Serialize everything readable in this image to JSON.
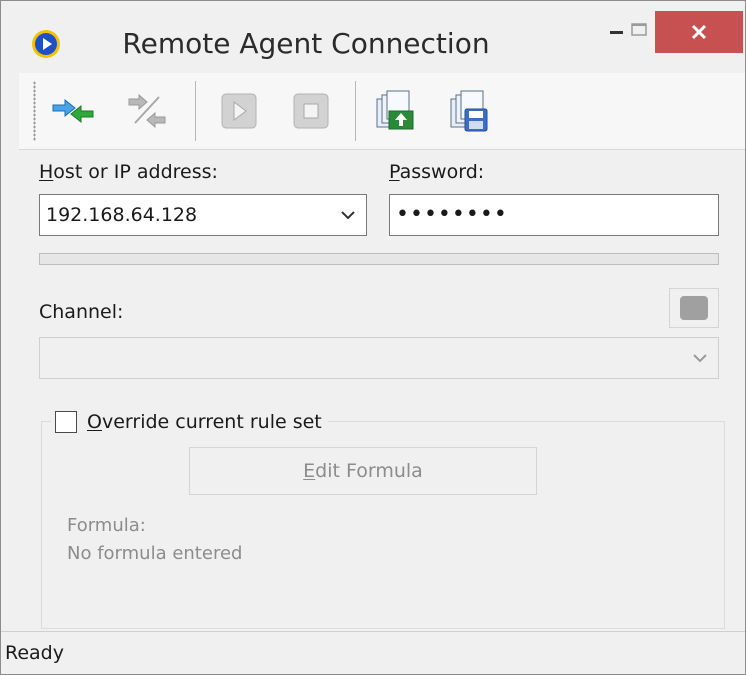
{
  "window": {
    "title": "Remote Agent Connection"
  },
  "toolbar": {
    "buttons": [
      {
        "icon": "connect-icon",
        "enabled": true
      },
      {
        "icon": "disconnect-icon",
        "enabled": false
      },
      {
        "icon": "play-icon",
        "enabled": false
      },
      {
        "icon": "stop-icon",
        "enabled": false
      },
      {
        "icon": "export-icon",
        "enabled": true
      },
      {
        "icon": "save-icon",
        "enabled": true
      }
    ]
  },
  "form": {
    "host_label_key": "H",
    "host_label_rest": "ost or IP address:",
    "host_value": "192.168.64.128",
    "password_label_key": "P",
    "password_label_rest": "assword:",
    "password_value": "••••••••",
    "progress_percent": 0,
    "channel_label": "Channel:",
    "channel_value": "",
    "override_key": "O",
    "override_rest": "verride current rule set",
    "override_checked": false,
    "edit_formula_key": "E",
    "edit_formula_rest": "dit Formula",
    "formula_label": "Formula:",
    "formula_value": "No formula entered"
  },
  "status": {
    "text": "Ready"
  },
  "colors": {
    "close_button": "#c75050",
    "app_icon": "#1f4fc8",
    "connect_arrow": "#4aa3e6",
    "connect_arrow_green": "#2faa3a"
  }
}
